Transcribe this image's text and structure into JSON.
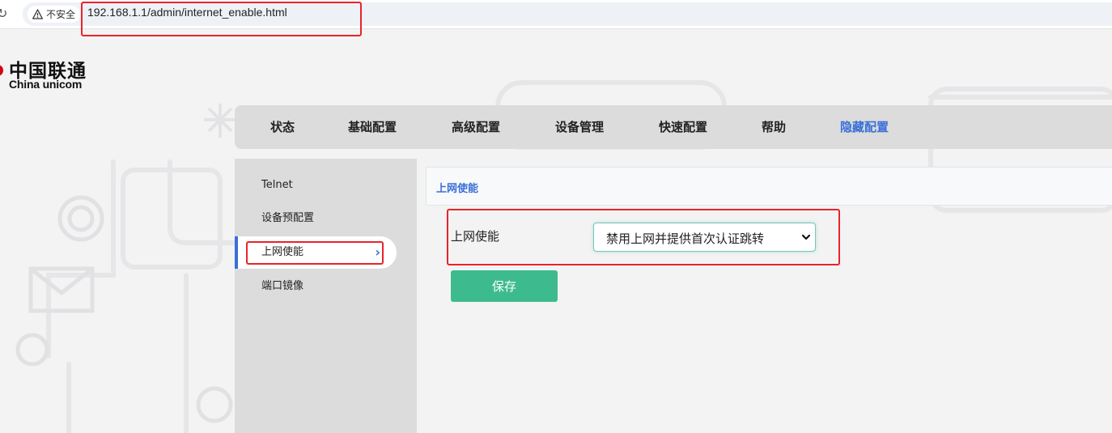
{
  "browser": {
    "security_label": "不安全",
    "url": "192.168.1.1/admin/internet_enable.html"
  },
  "logo": {
    "name_cn": "中国联通",
    "name_en": "China unicom"
  },
  "nav": {
    "items": [
      {
        "label": "状态"
      },
      {
        "label": "基础配置"
      },
      {
        "label": "高级配置"
      },
      {
        "label": "设备管理"
      },
      {
        "label": "快速配置"
      },
      {
        "label": "帮助"
      },
      {
        "label": "隐藏配置",
        "active": true
      }
    ]
  },
  "sidebar": {
    "items": [
      {
        "label": "Telnet"
      },
      {
        "label": "设备预配置"
      },
      {
        "label": "上网使能",
        "active": true
      },
      {
        "label": "端口镜像"
      }
    ]
  },
  "content": {
    "title": "上网使能",
    "field_label": "上网使能",
    "select_value": "禁用上网并提供首次认证跳转",
    "save_label": "保存"
  },
  "colors": {
    "accent": "#3a6fd8",
    "save_button": "#3dbb8f",
    "highlight": "#e8242a",
    "brand_red": "#d7000f"
  }
}
